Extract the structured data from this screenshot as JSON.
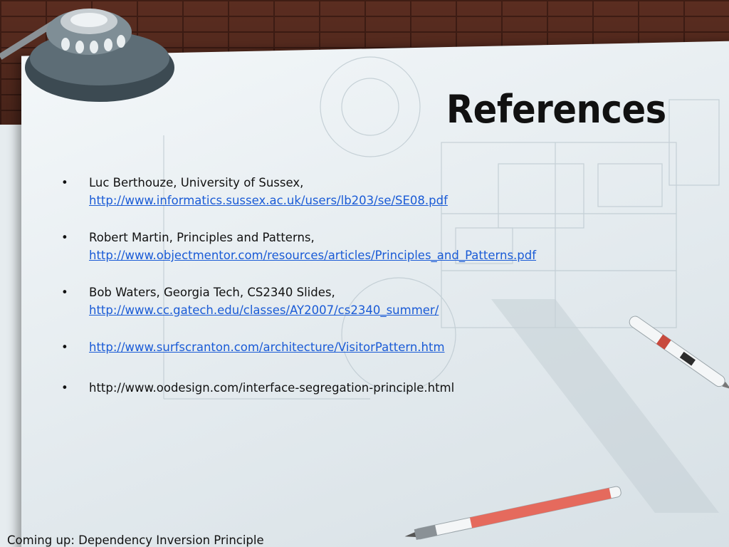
{
  "slide": {
    "title": "References",
    "references": [
      {
        "text": "Luc Berthouze, University of Sussex,",
        "link": "http://www.informatics.sussex.ac.uk/users/lb203/se/SE08.pdf"
      },
      {
        "text": "Robert Martin, Principles and Patterns,",
        "link": "http://www.objectmentor.com/resources/articles/Principles_and_Patterns.pdf"
      },
      {
        "text": "Bob Waters, Georgia Tech, CS2340 Slides,",
        "link": "http://www.cc.gatech.edu/classes/AY2007/cs2340_summer/"
      },
      {
        "link": "http://www.surfscranton.com/architecture/VisitorPattern.htm"
      },
      {
        "text": "http://www.oodesign.com/interface-segregation-principle.html"
      }
    ],
    "bullet_glyph": "•",
    "footer": "Coming up: Dependency Inversion Principle"
  },
  "colors": {
    "link": "#1a5bd6",
    "text": "#111111",
    "brick": "#6b3526"
  }
}
